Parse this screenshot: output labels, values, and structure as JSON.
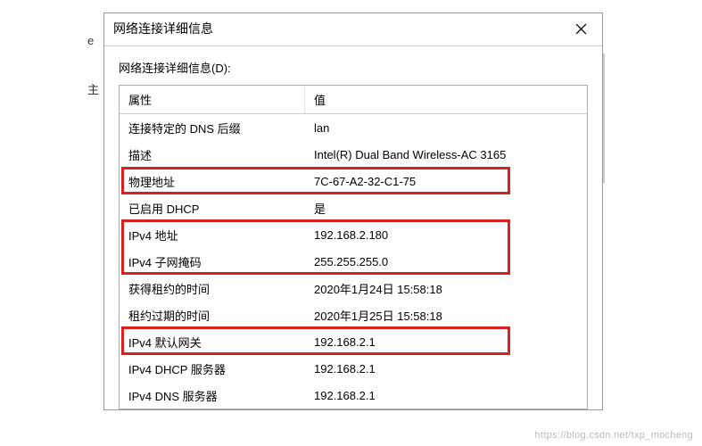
{
  "dialog": {
    "title": "网络连接详细信息",
    "section_label": "网络连接详细信息(D):",
    "columns": {
      "property": "属性",
      "value": "值"
    },
    "rows": [
      {
        "property": "连接特定的 DNS 后缀",
        "value": "lan",
        "highlight": false
      },
      {
        "property": "描述",
        "value": "Intel(R) Dual Band Wireless-AC 3165",
        "highlight": false
      },
      {
        "property": "物理地址",
        "value": "7C-67-A2-32-C1-75",
        "highlight": true
      },
      {
        "property": "已启用 DHCP",
        "value": "是",
        "highlight": false
      },
      {
        "property": "IPv4 地址",
        "value": "192.168.2.180",
        "highlight": true
      },
      {
        "property": "IPv4 子网掩码",
        "value": "255.255.255.0",
        "highlight": true
      },
      {
        "property": "获得租约的时间",
        "value": "2020年1月24日 15:58:18",
        "highlight": false
      },
      {
        "property": "租约过期的时间",
        "value": "2020年1月25日 15:58:18",
        "highlight": false
      },
      {
        "property": "IPv4 默认网关",
        "value": "192.168.2.1",
        "highlight": true
      },
      {
        "property": "IPv4 DHCP 服务器",
        "value": "192.168.2.1",
        "highlight": false
      },
      {
        "property": "IPv4 DNS 服务器",
        "value": "192.168.2.1",
        "highlight": false
      }
    ]
  },
  "watermark": "https://blog.csdn.net/txp_mocheng",
  "stray": {
    "e": "e",
    "bracket": "主"
  }
}
